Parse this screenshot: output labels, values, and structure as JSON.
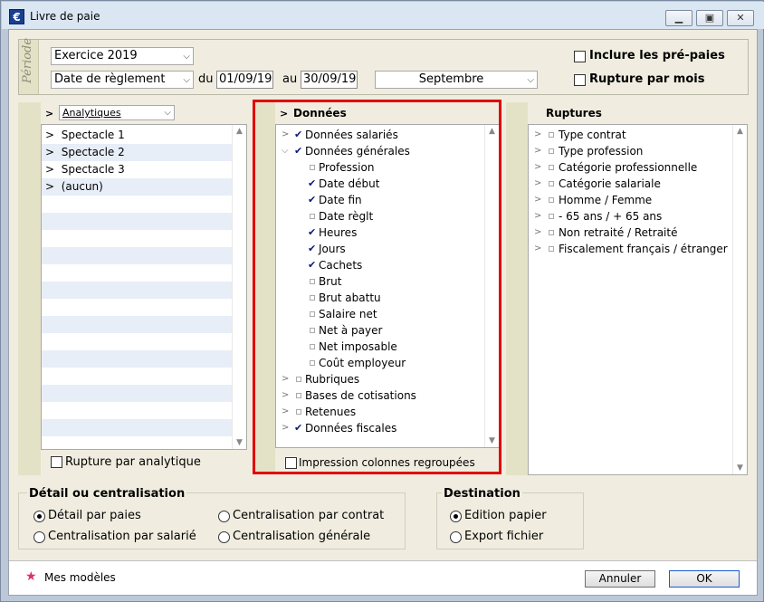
{
  "window": {
    "title": "Livre de paie",
    "app_icon_glyph": "€"
  },
  "periode": {
    "side_label": "Période",
    "exercice": "Exercice 2019",
    "date_type": "Date de règlement",
    "du_label": "du",
    "date_from": "01/09/19",
    "au_label": "au",
    "date_to": "30/09/19",
    "month": "Septembre",
    "inclure_prepaies": "Inclure les pré-paies",
    "rupture_mois": "Rupture par mois"
  },
  "analytique": {
    "header_chevron": ">",
    "dropdown": "Analytiques",
    "items": [
      {
        "chevron": ">",
        "label": "Spectacle 1"
      },
      {
        "chevron": ">",
        "label": "Spectacle 2"
      },
      {
        "chevron": ">",
        "label": "Spectacle 3"
      },
      {
        "chevron": ">",
        "label": "(aucun)"
      }
    ],
    "rupture_label": "Rupture par analytique"
  },
  "donnees": {
    "header_chevron": ">",
    "title": "Données",
    "items": [
      {
        "label": "Données salariés",
        "chev": ">",
        "check": true,
        "indent": 0
      },
      {
        "label": "Données générales",
        "chev": "v",
        "check": true,
        "indent": 0
      },
      {
        "label": "Profession",
        "check": false,
        "indent": 1
      },
      {
        "label": "Date début",
        "check": true,
        "indent": 1
      },
      {
        "label": "Date fin",
        "check": true,
        "indent": 1
      },
      {
        "label": "Date règlt",
        "check": false,
        "indent": 1
      },
      {
        "label": "Heures",
        "check": true,
        "indent": 1
      },
      {
        "label": "Jours",
        "check": true,
        "indent": 1
      },
      {
        "label": "Cachets",
        "check": true,
        "indent": 1
      },
      {
        "label": "Brut",
        "check": false,
        "indent": 1
      },
      {
        "label": "Brut abattu",
        "check": false,
        "indent": 1
      },
      {
        "label": "Salaire net",
        "check": false,
        "indent": 1
      },
      {
        "label": "Net à payer",
        "check": false,
        "indent": 1
      },
      {
        "label": "Net imposable",
        "check": false,
        "indent": 1
      },
      {
        "label": "Coût employeur",
        "check": false,
        "indent": 1
      },
      {
        "label": "Rubriques",
        "chev": ">",
        "check": false,
        "indent": 0
      },
      {
        "label": "Bases de cotisations",
        "chev": ">",
        "check": false,
        "indent": 0
      },
      {
        "label": "Retenues",
        "chev": ">",
        "check": false,
        "indent": 0
      },
      {
        "label": "Données fiscales",
        "chev": ">",
        "check": true,
        "indent": 0
      }
    ],
    "impression_label": "Impression colonnes regroupées"
  },
  "ruptures": {
    "title": "Ruptures",
    "items": [
      {
        "label": "Type contrat"
      },
      {
        "label": "Type profession"
      },
      {
        "label": "Catégorie professionnelle"
      },
      {
        "label": "Catégorie salariale"
      },
      {
        "label": "Homme / Femme"
      },
      {
        "label": "- 65 ans / + 65 ans"
      },
      {
        "label": "Non retraité / Retraité"
      },
      {
        "label": "Fiscalement français / étranger"
      }
    ]
  },
  "detail": {
    "title": "Détail ou centralisation",
    "options": [
      {
        "label": "Détail par paies",
        "selected": true
      },
      {
        "label": "Centralisation par contrat",
        "selected": false
      },
      {
        "label": "Centralisation par salarié",
        "selected": false
      },
      {
        "label": "Centralisation générale",
        "selected": false
      }
    ]
  },
  "destination": {
    "title": "Destination",
    "options": [
      {
        "label": "Edition papier",
        "selected": true
      },
      {
        "label": "Export fichier",
        "selected": false
      }
    ]
  },
  "footer": {
    "models_label": "Mes modèles",
    "cancel": "Annuler",
    "ok": "OK"
  },
  "colors": {
    "highlight_border": "#e00000",
    "check": "#0a1a7a",
    "star": "#d6336c"
  }
}
